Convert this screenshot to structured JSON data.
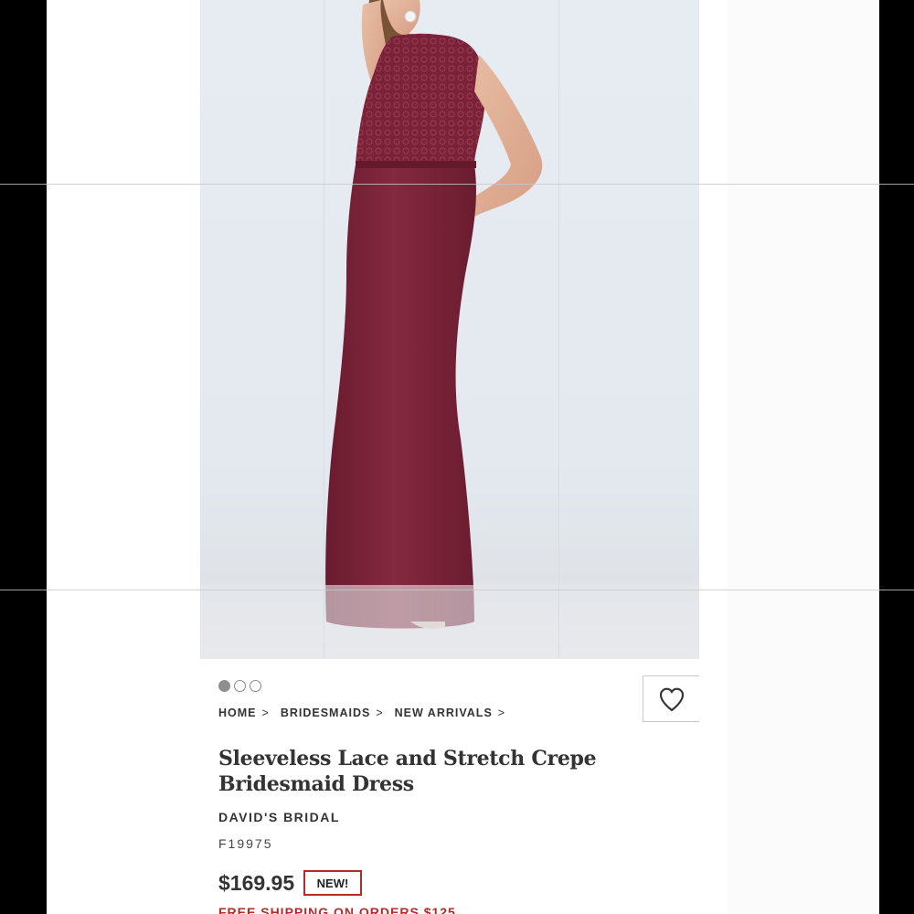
{
  "product": {
    "breadcrumb": [
      {
        "label": "HOME"
      },
      {
        "label": "BRIDESMAIDS"
      },
      {
        "label": "NEW ARRIVALS"
      }
    ],
    "title_line1": "Sleeveless Lace and Stretch Crepe",
    "title_line2": "Bridesmaid Dress",
    "brand": "DAVID'S BRIDAL",
    "sku": "F19975",
    "price": "$169.95",
    "badge": "NEW!",
    "promo": "FREE SHIPPING ON ORDERS $125"
  },
  "gallery": {
    "total": 3,
    "active": 1,
    "image_alt": "model wearing wine sleeveless lace and crepe bridesmaid dress"
  },
  "colors": {
    "dress": "#7a2237",
    "accent": "#b12b2b"
  },
  "icons": {
    "favorite": "heart-icon"
  }
}
